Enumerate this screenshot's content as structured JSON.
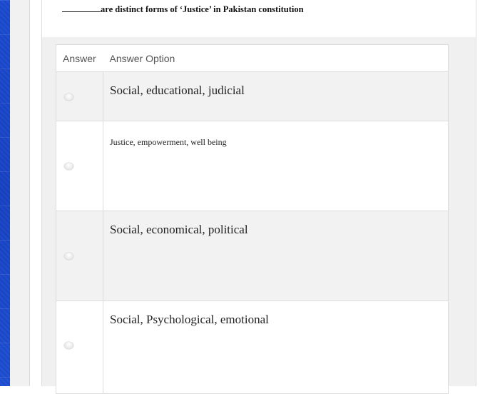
{
  "question": {
    "text": "are distinct forms of ‘Justice’ in Pakistan constitution"
  },
  "table": {
    "headers": {
      "answer": "Answer",
      "option": "Answer Option"
    },
    "options": [
      {
        "label": "Social, educational, judicial"
      },
      {
        "label": "Justice, empowerment, well being"
      },
      {
        "label": "Social, economical, political"
      },
      {
        "label": "Social, Psychological, emotional"
      }
    ]
  }
}
